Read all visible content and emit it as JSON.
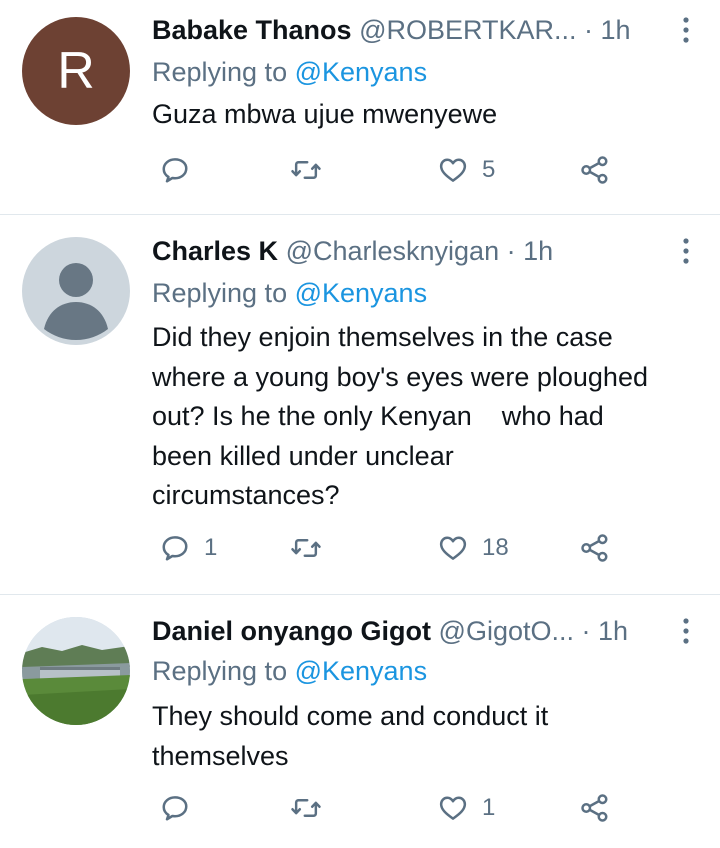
{
  "tweets": [
    {
      "avatar_letter": "R",
      "avatar_color": "#6d4133",
      "name": "Babake Thanos",
      "handle": "@ROBERTKAR...",
      "time": "· 1h",
      "replying_prefix": "Replying to ",
      "replying_to": "@Kenyans",
      "text": "Guza mbwa ujue mwenyewe",
      "replies": "",
      "retweets": "",
      "likes": "5"
    },
    {
      "name": "Charles K",
      "handle": "@Charlesknyigan",
      "time": "· 1h",
      "replying_prefix": "Replying to ",
      "replying_to": "@Kenyans",
      "text_lines": [
        "Did they enjoin themselves in the case",
        "where a young boy's eyes were ploughed",
        "out? Is he the only Kenyan    who had",
        "been killed under unclear",
        "circumstances?"
      ],
      "replies": "1",
      "retweets": "",
      "likes": "18"
    },
    {
      "name": "Daniel onyango Gigot",
      "handle": "@GigotO...",
      "time": "· 1h",
      "replying_prefix": "Replying to ",
      "replying_to": "@Kenyans",
      "text_lines": [
        "They should come and conduct it",
        "themselves"
      ],
      "replies": "",
      "retweets": "",
      "likes": "1"
    }
  ],
  "icons": {
    "reply": "reply-icon",
    "retweet": "retweet-icon",
    "like": "heart-icon",
    "share": "share-icon",
    "more": "more-vertical-icon"
  },
  "colors": {
    "secondary_text": "#5b7083",
    "link": "#1b95e0",
    "divider": "#e1e8ed"
  }
}
